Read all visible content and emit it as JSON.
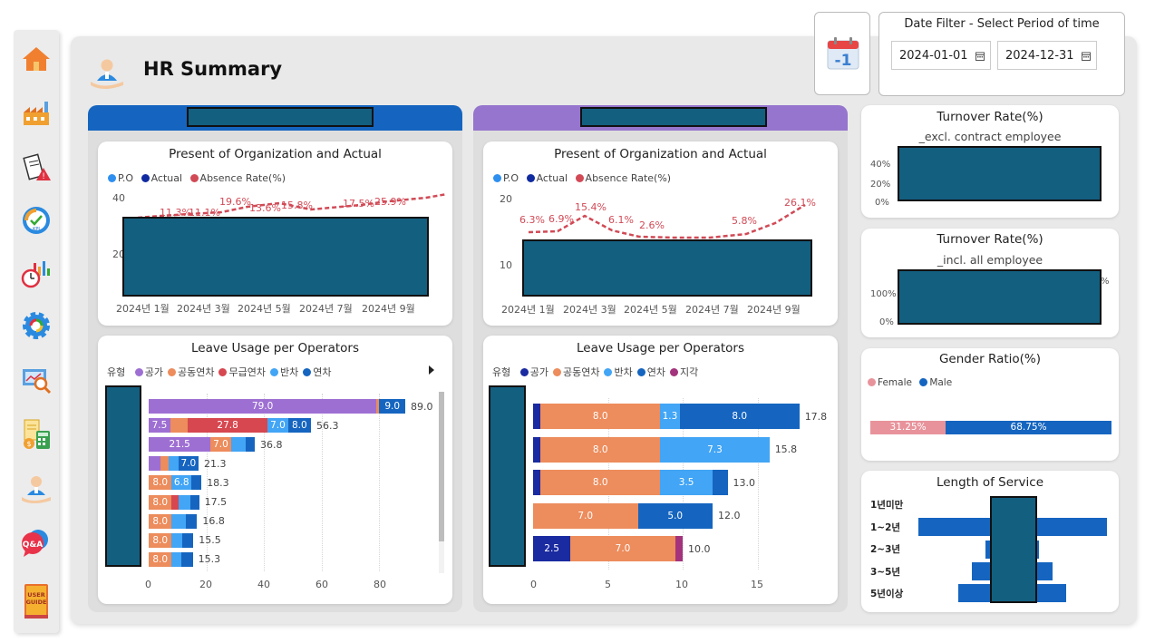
{
  "colors": {
    "blue_header": "#1565c0",
    "purple_header": "#9575cd",
    "redacted": "#135f80",
    "po": "#2f8ff0",
    "actual": "#102aa0",
    "absence": "#d14a56",
    "female": "#e8939b",
    "male": "#1565c0"
  },
  "nav": [
    {
      "name": "home-icon"
    },
    {
      "name": "factory-icon"
    },
    {
      "name": "document-alert-icon"
    },
    {
      "name": "kpi-gauge-icon"
    },
    {
      "name": "stopwatch-chart-icon"
    },
    {
      "name": "settings-gear-icon"
    },
    {
      "name": "analysis-search-icon"
    },
    {
      "name": "calculator-icon"
    },
    {
      "name": "hr-person-icon"
    },
    {
      "name": "qna-icon"
    },
    {
      "name": "user-guide-icon",
      "label": "USER GUIDE"
    }
  ],
  "header": {
    "title": "HR Summary"
  },
  "date_filter": {
    "label": "Date Filter - Select Period of time",
    "start": "2024-01-01",
    "end": "2024-12-31"
  },
  "panels": {
    "po_title": "Present of Organization and Actual",
    "legend_po": "P.O",
    "legend_actual": "Actual",
    "legend_absence": "Absence Rate(%)",
    "leave_title": "Leave Usage per Operators",
    "leave_legend_title": "유형",
    "left": {
      "y_ticks": [
        "40",
        "20"
      ],
      "x_labels": [
        "2024년 1월",
        "2024년 3월",
        "2024년 5월",
        "2024년 7월",
        "2024년 9월"
      ],
      "absence_labels": [
        "11.3%",
        "11.1%",
        "19.6%",
        "13.6%",
        "15.8%",
        "17.5%",
        "25.9%"
      ],
      "leave_legend": [
        {
          "label": "공가",
          "color": "#9e6fd3"
        },
        {
          "label": "공동연차",
          "color": "#ed8c5c"
        },
        {
          "label": "무급연차",
          "color": "#d6474f"
        },
        {
          "label": "반차",
          "color": "#42a5f5"
        },
        {
          "label": "연차",
          "color": "#1565c0"
        }
      ],
      "leave_rows": [
        {
          "total": "89.0",
          "segments": [
            {
              "v": 79.0,
              "c": "#9e6fd3",
              "label": "79.0"
            },
            {
              "v": 1.0,
              "c": "#ed8c5c",
              "label": ""
            },
            {
              "v": 9.0,
              "c": "#1565c0",
              "label": "9.0"
            }
          ]
        },
        {
          "total": "56.3",
          "segments": [
            {
              "v": 7.5,
              "c": "#9e6fd3",
              "label": "7.5"
            },
            {
              "v": 6.0,
              "c": "#ed8c5c",
              "label": ""
            },
            {
              "v": 27.8,
              "c": "#d6474f",
              "label": "27.8"
            },
            {
              "v": 7.0,
              "c": "#42a5f5",
              "label": "7.0"
            },
            {
              "v": 8.0,
              "c": "#1565c0",
              "label": "8.0"
            }
          ]
        },
        {
          "total": "36.8",
          "segments": [
            {
              "v": 21.5,
              "c": "#9e6fd3",
              "label": "21.5"
            },
            {
              "v": 7.0,
              "c": "#ed8c5c",
              "label": "7.0"
            },
            {
              "v": 5.3,
              "c": "#42a5f5",
              "label": ""
            },
            {
              "v": 3.0,
              "c": "#1565c0",
              "label": ""
            }
          ]
        },
        {
          "total": "21.3",
          "segments": [
            {
              "v": 4.0,
              "c": "#9e6fd3",
              "label": ""
            },
            {
              "v": 3.0,
              "c": "#ed8c5c",
              "label": ""
            },
            {
              "v": 3.3,
              "c": "#42a5f5",
              "label": ""
            },
            {
              "v": 7.0,
              "c": "#1565c0",
              "label": "7.0"
            }
          ]
        },
        {
          "total": "18.3",
          "segments": [
            {
              "v": 8.0,
              "c": "#ed8c5c",
              "label": "8.0"
            },
            {
              "v": 6.8,
              "c": "#42a5f5",
              "label": "6.8"
            },
            {
              "v": 3.5,
              "c": "#1565c0",
              "label": ""
            }
          ]
        },
        {
          "total": "17.5",
          "segments": [
            {
              "v": 8.0,
              "c": "#ed8c5c",
              "label": "8.0"
            },
            {
              "v": 2.5,
              "c": "#d6474f",
              "label": ""
            },
            {
              "v": 4.0,
              "c": "#42a5f5",
              "label": ""
            },
            {
              "v": 3.0,
              "c": "#1565c0",
              "label": ""
            }
          ]
        },
        {
          "total": "16.8",
          "segments": [
            {
              "v": 8.0,
              "c": "#ed8c5c",
              "label": "8.0"
            },
            {
              "v": 4.8,
              "c": "#42a5f5",
              "label": ""
            },
            {
              "v": 4.0,
              "c": "#1565c0",
              "label": ""
            }
          ]
        },
        {
          "total": "15.5",
          "segments": [
            {
              "v": 8.0,
              "c": "#ed8c5c",
              "label": "8.0"
            },
            {
              "v": 3.5,
              "c": "#42a5f5",
              "label": ""
            },
            {
              "v": 4.0,
              "c": "#1565c0",
              "label": ""
            }
          ]
        },
        {
          "total": "15.3",
          "segments": [
            {
              "v": 8.0,
              "c": "#ed8c5c",
              "label": "8.0"
            },
            {
              "v": 3.3,
              "c": "#42a5f5",
              "label": ""
            },
            {
              "v": 4.0,
              "c": "#1565c0",
              "label": ""
            }
          ]
        }
      ],
      "x_ticks": [
        "0",
        "20",
        "40",
        "60",
        "80"
      ]
    },
    "right": {
      "y_ticks": [
        "20",
        "10"
      ],
      "x_labels": [
        "2024년 1월",
        "2024년 3월",
        "2024년 5월",
        "2024년 7월",
        "2024년 9월"
      ],
      "absence_labels": [
        "6.3%",
        "6.9%",
        "15.4%",
        "6.1%",
        "2.6%",
        "5.8%",
        "26.1%"
      ],
      "leave_legend": [
        {
          "label": "공가",
          "color": "#1a2aa0"
        },
        {
          "label": "공동연차",
          "color": "#ed8c5c"
        },
        {
          "label": "반차",
          "color": "#42a5f5"
        },
        {
          "label": "연차",
          "color": "#1565c0"
        },
        {
          "label": "지각",
          "color": "#a3337c"
        }
      ],
      "leave_rows": [
        {
          "total": "17.8",
          "segments": [
            {
              "v": 0.5,
              "c": "#1a2aa0",
              "label": ""
            },
            {
              "v": 8.0,
              "c": "#ed8c5c",
              "label": "8.0"
            },
            {
              "v": 1.3,
              "c": "#42a5f5",
              "label": "1.3"
            },
            {
              "v": 8.0,
              "c": "#1565c0",
              "label": "8.0"
            }
          ]
        },
        {
          "total": "15.8",
          "segments": [
            {
              "v": 0.5,
              "c": "#1a2aa0",
              "label": ""
            },
            {
              "v": 8.0,
              "c": "#ed8c5c",
              "label": "8.0"
            },
            {
              "v": 7.3,
              "c": "#42a5f5",
              "label": "7.3"
            }
          ]
        },
        {
          "total": "13.0",
          "segments": [
            {
              "v": 0.5,
              "c": "#1a2aa0",
              "label": ""
            },
            {
              "v": 8.0,
              "c": "#ed8c5c",
              "label": "8.0"
            },
            {
              "v": 3.5,
              "c": "#42a5f5",
              "label": "3.5"
            },
            {
              "v": 1.0,
              "c": "#1565c0",
              "label": ""
            }
          ]
        },
        {
          "total": "12.0",
          "segments": [
            {
              "v": 7.0,
              "c": "#ed8c5c",
              "label": "7.0"
            },
            {
              "v": 5.0,
              "c": "#1565c0",
              "label": "5.0"
            }
          ]
        },
        {
          "total": "10.0",
          "segments": [
            {
              "v": 2.5,
              "c": "#1a2aa0",
              "label": "2.5"
            },
            {
              "v": 7.0,
              "c": "#ed8c5c",
              "label": "7.0"
            },
            {
              "v": 0.5,
              "c": "#a3337c",
              "label": ""
            }
          ]
        }
      ],
      "x_ticks": [
        "0",
        "5",
        "10",
        "15"
      ]
    }
  },
  "turnover_excl": {
    "title": "Turnover Rate(%)",
    "subtitle": "_excl. contract employee",
    "y_ticks": [
      "40%",
      "20%",
      "0%"
    ]
  },
  "turnover_incl": {
    "title": "Turnover Rate(%)",
    "subtitle": "_incl. all employee",
    "y_ticks": [
      "100%",
      "0%"
    ],
    "partial_label": "%"
  },
  "gender": {
    "title": "Gender Ratio(%)",
    "female_label": "Female",
    "male_label": "Male",
    "female_pct": 31.25,
    "male_pct": 68.75,
    "female_text": "31.25%",
    "male_text": "68.75%"
  },
  "service": {
    "title": "Length of Service",
    "categories": [
      "1년미만",
      "1~2년",
      "2~3년",
      "3~5년",
      "5년이상"
    ]
  }
}
